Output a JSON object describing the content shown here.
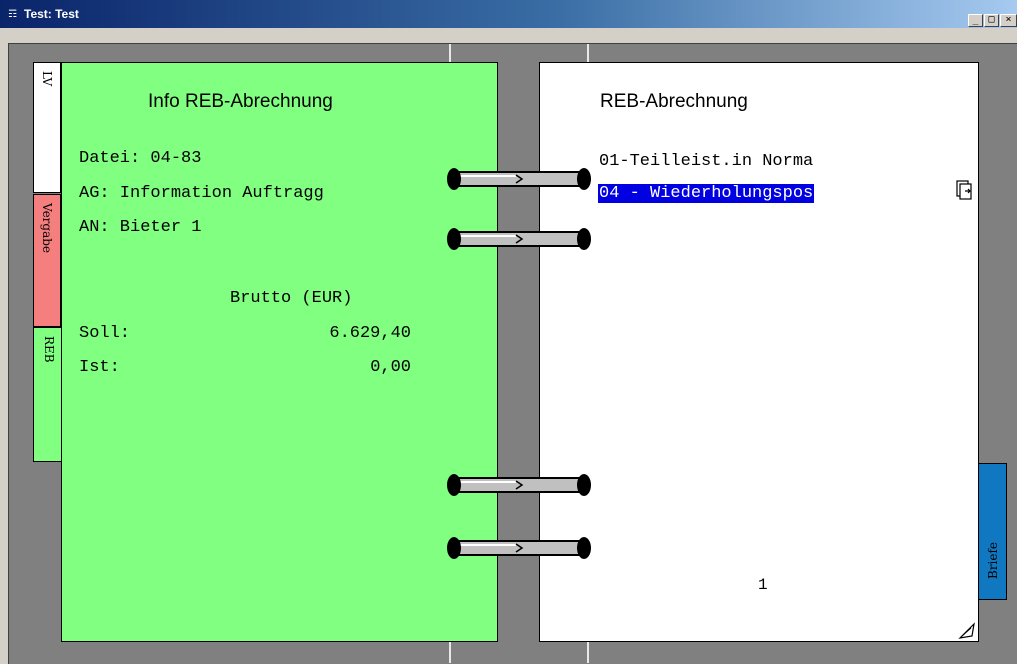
{
  "window": {
    "title": "Test: Test",
    "app_icon": "book-icon",
    "buttons": {
      "minimize": "_",
      "maximize": "□",
      "close": "×"
    }
  },
  "left_page": {
    "heading": "Info REB-Abrechnung",
    "datei": "Datei: 04-83",
    "ag": "AG: Information Auftragg",
    "an": "AN: Bieter 1",
    "brutto_header": "Brutto (EUR)",
    "soll_label": "Soll:",
    "soll_value": "6.629,40",
    "ist_label": "Ist:",
    "ist_value": "0,00",
    "color": "#80ff80"
  },
  "tabs": {
    "lv": "LV",
    "vergabe": "Vergabe",
    "reb": "REB",
    "briefe": "Briefe"
  },
  "right_page": {
    "heading": "REB-Abrechnung",
    "items": [
      {
        "label": "01-Teilleist.in Norma",
        "selected": false
      },
      {
        "label": "04 - Wiederholungspos",
        "selected": true
      }
    ],
    "page_number": "1",
    "selection_color": "#0000e0"
  }
}
